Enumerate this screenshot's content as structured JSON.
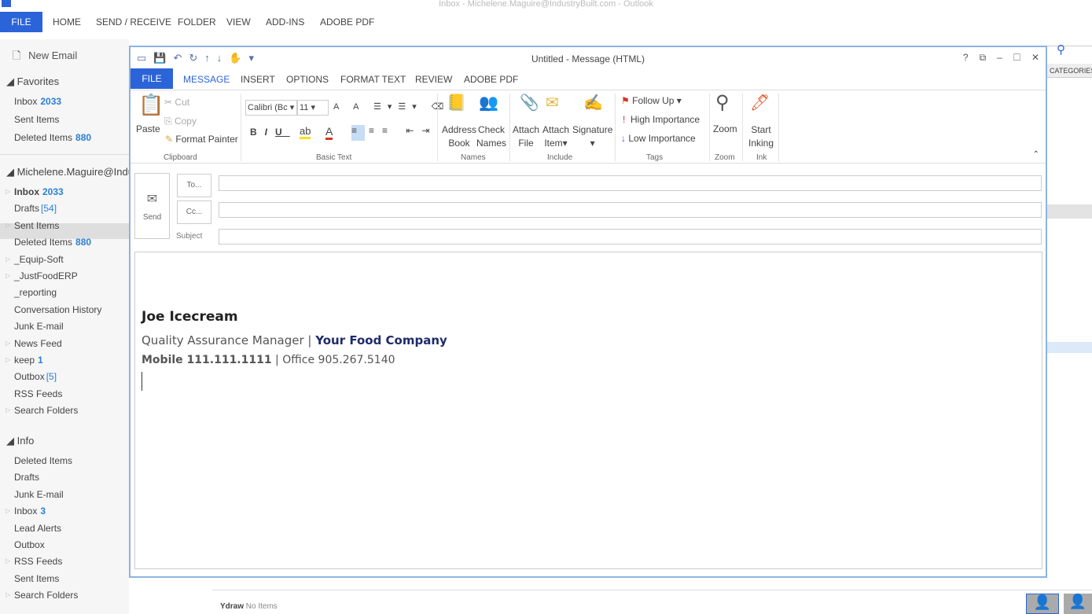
{
  "outlook": {
    "window_title": "Inbox - Michelene.Maguire@IndustryBuilt.com - Outlook",
    "ribbon_tabs": [
      "FILE",
      "HOME",
      "SEND / RECEIVE",
      "FOLDER",
      "VIEW",
      "ADD-INS",
      "ADOBE PDF"
    ],
    "new_email": "New Email",
    "favorites": {
      "label": "Favorites",
      "items": [
        {
          "label": "Inbox",
          "count": "2033"
        },
        {
          "label": "Sent Items",
          "count": ""
        },
        {
          "label": "Deleted Items",
          "count": "880"
        }
      ]
    },
    "account": {
      "label": "Michelene.Maguire@Indu",
      "items": [
        {
          "label": "Inbox",
          "count": "2033"
        },
        {
          "label": "Drafts",
          "count": "[54]"
        },
        {
          "label": "Sent Items",
          "count": ""
        },
        {
          "label": "Deleted Items",
          "count": "880"
        },
        {
          "label": "_Equip-Soft",
          "count": ""
        },
        {
          "label": "_JustFoodERP",
          "count": ""
        },
        {
          "label": "_reporting",
          "count": ""
        },
        {
          "label": "Conversation History",
          "count": ""
        },
        {
          "label": "Junk E-mail",
          "count": ""
        },
        {
          "label": "News Feed",
          "count": ""
        },
        {
          "label": "keep",
          "count": "1"
        },
        {
          "label": "Outbox",
          "count": "[5]"
        },
        {
          "label": "RSS Feeds",
          "count": ""
        },
        {
          "label": "Search Folders",
          "count": ""
        }
      ]
    },
    "info": {
      "label": "Info",
      "items": [
        {
          "label": "Deleted Items",
          "count": ""
        },
        {
          "label": "Drafts",
          "count": ""
        },
        {
          "label": "Junk E-mail",
          "count": ""
        },
        {
          "label": "Inbox",
          "count": "3"
        },
        {
          "label": "Lead Alerts",
          "count": ""
        },
        {
          "label": "Outbox",
          "count": ""
        },
        {
          "label": "RSS Feeds",
          "count": ""
        },
        {
          "label": "Sent Items",
          "count": ""
        },
        {
          "label": "Search Folders",
          "count": ""
        }
      ]
    },
    "categories": "CATEGORIES",
    "people_pane": {
      "name": "Ydraw",
      "status": "No Items"
    }
  },
  "message": {
    "title": "Untitled - Message (HTML)",
    "window_buttons": [
      "?",
      "⧉",
      "–",
      "☐",
      "✕"
    ],
    "tabs": [
      "FILE",
      "MESSAGE",
      "INSERT",
      "OPTIONS",
      "FORMAT TEXT",
      "REVIEW",
      "ADOBE PDF"
    ],
    "ribbon": {
      "paste": "Paste",
      "cut": "Cut",
      "copy": "Copy",
      "format_painter": "Format Painter",
      "clipboard": "Clipboard",
      "font": "Calibri (Bc",
      "size": "11",
      "basic_text": "Basic Text",
      "address_book": [
        "Address",
        "Book"
      ],
      "check_names": [
        "Check",
        "Names"
      ],
      "names": "Names",
      "attach_file": [
        "Attach",
        "File"
      ],
      "attach_item": [
        "Attach",
        "Item"
      ],
      "signature": "Signature",
      "include": "Include",
      "follow_up": "Follow Up",
      "high_importance": "High Importance",
      "low_importance": "Low Importance",
      "tags": "Tags",
      "zoom": "Zoom",
      "zoom_group": "Zoom",
      "start_inking": [
        "Start",
        "Inking"
      ],
      "ink": "Ink"
    },
    "send": "Send",
    "to": "To...",
    "cc": "Cc...",
    "subject_label": "Subject",
    "to_value": "",
    "cc_value": "",
    "subject_value": "",
    "signature": {
      "name": "Joe Icecream",
      "title": "Quality Assurance Manager",
      "separator": "|",
      "company": "Your Food Company",
      "mobile": "Mobile 111.111.1111",
      "office": "Office 905.267.5140"
    },
    "accent": "#2b64d8",
    "company_color": "#1f2a6b"
  }
}
